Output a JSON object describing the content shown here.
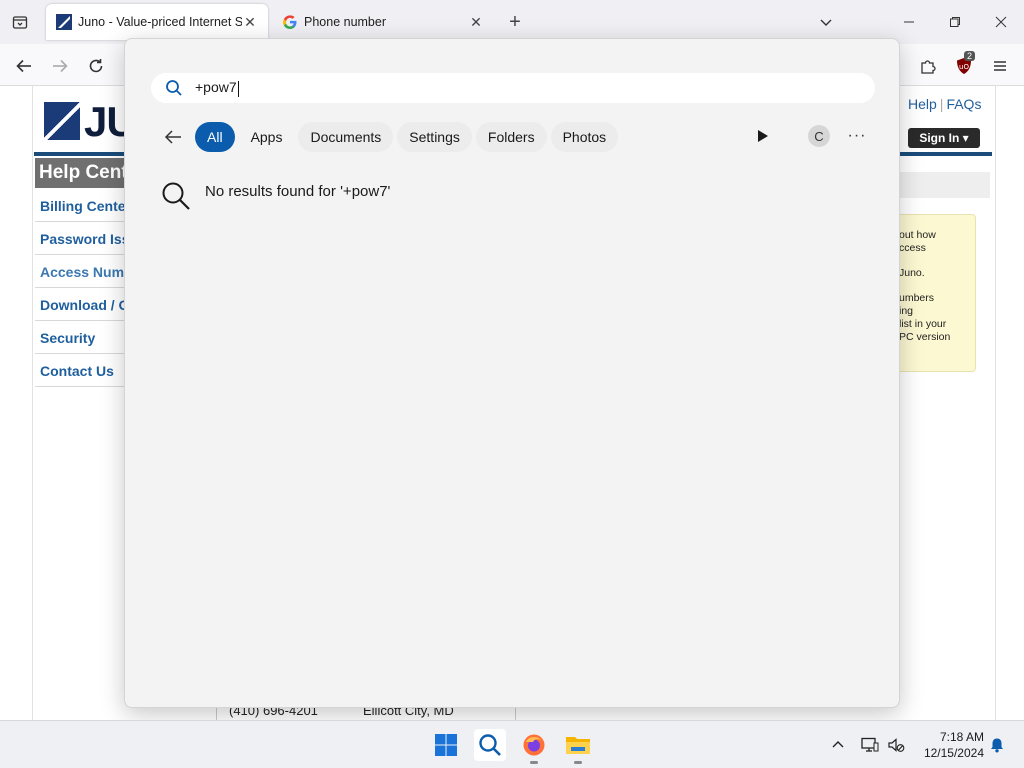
{
  "browser": {
    "tabs": [
      {
        "title": "Juno - Value-priced Internet Ser",
        "active": true
      },
      {
        "title": "Phone number",
        "active": false
      }
    ],
    "extension_badge": "2"
  },
  "page": {
    "logo_text": "JU",
    "top_links": {
      "help": "Help",
      "sep": "|",
      "faqs": "FAQs"
    },
    "signin_label": "Sign In ▾",
    "help_center_title": "Help Cent",
    "sidebar": [
      {
        "label": "Billing Center"
      },
      {
        "label": "Password Issu"
      },
      {
        "label": "Access Numbe"
      },
      {
        "label": "Download / O"
      },
      {
        "label": "Security"
      },
      {
        "label": "Contact Us"
      }
    ],
    "note_lines": [
      "out how",
      "ccess",
      "Juno.",
      "umbers",
      "ing",
      "list in your",
      "PC version"
    ],
    "bottom_row": {
      "phone": "(410) 696-4201",
      "city": "Ellicott City, MD"
    }
  },
  "search": {
    "query": "+pow7",
    "filters": [
      {
        "label": "All",
        "active": true
      },
      {
        "label": "Apps",
        "active": false
      },
      {
        "label": "Documents",
        "active": false
      },
      {
        "label": "Settings",
        "active": false
      },
      {
        "label": "Folders",
        "active": false
      },
      {
        "label": "Photos",
        "active": false
      }
    ],
    "avatar_initial": "C",
    "more_label": "···",
    "no_results_text": "No results found for '+pow7'"
  },
  "taskbar": {
    "time": "7:18 AM",
    "date": "12/15/2024",
    "apps": [
      "windows-start",
      "search",
      "firefox",
      "file-explorer"
    ]
  },
  "colors": {
    "accent": "#0b5cad",
    "juno_blue": "#1b4c7a",
    "link_blue": "#1f5f9e"
  }
}
